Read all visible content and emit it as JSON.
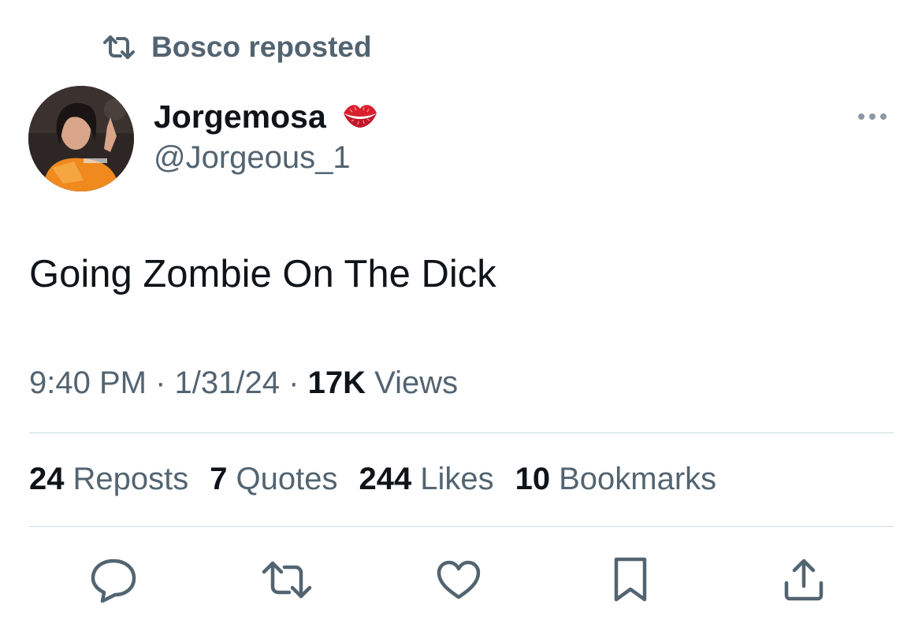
{
  "repost": {
    "icon": "repost-icon",
    "text": "Bosco reposted"
  },
  "author": {
    "display_name": "Jorgemosa",
    "badge_emoji": "kiss-mark-icon",
    "handle": "@Jorgeous_1"
  },
  "tweet": {
    "text": "Going Zombie On The Dick"
  },
  "meta": {
    "time": "9:40 PM",
    "sep1": "·",
    "date": "1/31/24",
    "sep2": "·",
    "views_count": "17K",
    "views_label": "Views"
  },
  "stats": [
    {
      "count": "24",
      "label": "Reposts"
    },
    {
      "count": "7",
      "label": "Quotes"
    },
    {
      "count": "244",
      "label": "Likes"
    },
    {
      "count": "10",
      "label": "Bookmarks"
    }
  ],
  "actions": [
    "reply-icon",
    "repost-icon",
    "like-icon",
    "bookmark-icon",
    "share-icon"
  ],
  "colors": {
    "primary_text": "#0f1419",
    "secondary_text": "#536471",
    "divider": "#cfd9de",
    "icon": "#536471",
    "avatar_dress": "#f08a1e",
    "lips": "#d8202f"
  }
}
